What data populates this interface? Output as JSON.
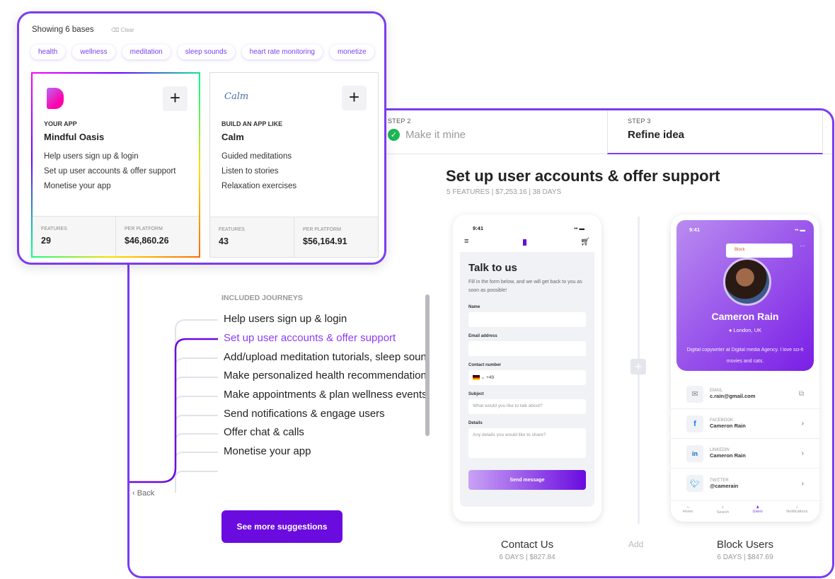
{
  "filter": {
    "showing": "Showing 6 bases",
    "clear": "Clear",
    "tags": [
      "health",
      "wellness",
      "meditation",
      "sleep sounds",
      "heart rate monitoring",
      "monetize"
    ]
  },
  "cards": [
    {
      "label": "YOUR APP",
      "name": "Mindful Oasis",
      "features": [
        "Help users sign up & login",
        "Set up user accounts & offer support",
        "Monetise your app"
      ],
      "features_label": "FEATURES",
      "features_count": "29",
      "price_label": "PER PLATFORM",
      "price": "$46,860.26",
      "logo": "B"
    },
    {
      "label": "BUILD AN APP LIKE",
      "name": "Calm",
      "features": [
        "Guided meditations",
        "Listen to stories",
        "Relaxation exercises"
      ],
      "features_label": "FEATURES",
      "features_count": "43",
      "price_label": "PER PLATFORM",
      "price": "$56,164.91",
      "logo": "Calm"
    }
  ],
  "steps": [
    {
      "step": "STEP 2",
      "title": "Make it mine",
      "done": true
    },
    {
      "step": "STEP 3",
      "title": "Refine idea",
      "active": true
    }
  ],
  "journey": {
    "title": "Set up user accounts & offer support",
    "meta": "5 FEATURES | $7,253.16 | 38 DAYS",
    "included_label": "INCLUDED JOURNEYS",
    "items": [
      "Help users sign up & login",
      "Set up user accounts & offer support",
      "Add/upload meditation tutorials, sleep sounds",
      "Make personalized health recommendations",
      "Make appointments & plan wellness events",
      "Send notifications & engage users",
      "Offer chat & calls",
      "Monetise your app"
    ],
    "back": "Back",
    "more_button": "See more suggestions",
    "accent": "#7b3cf0"
  },
  "contact_phone": {
    "time": "9:41",
    "heading": "Talk to us",
    "intro": "Fill in the form below, and we will get back to you as soon as possible!",
    "name_label": "Name",
    "email_label": "Email address",
    "contact_label": "Contact number",
    "dial_code": "+49",
    "subject_label": "Subject",
    "subject_placeholder": "What would you like to talk about?",
    "details_label": "Details",
    "details_placeholder": "Any details you would like to share?",
    "send": "Send message"
  },
  "profile_phone": {
    "time": "9:41",
    "menu_item": "Block",
    "name": "Cameron Rain",
    "location": "London, UK",
    "bio": "Digital copywriter at Digital media Agency. I love sci-fi movies and cats.",
    "rows": [
      {
        "label": "EMAIL",
        "value": "c.rain@gmail.com",
        "icon": "mail"
      },
      {
        "label": "FACEBOOK",
        "value": "Cameron Rain",
        "icon": "facebook"
      },
      {
        "label": "LINKEDIN",
        "value": "Cameron Rain",
        "icon": "linkedin"
      },
      {
        "label": "TWITTER",
        "value": "@camerain",
        "icon": "twitter"
      }
    ],
    "nav": [
      "Home",
      "Search",
      "Users",
      "Notifications"
    ]
  },
  "features": [
    {
      "name": "Contact Us",
      "meta": "6 DAYS | $827.84"
    },
    {
      "name": "Block Users",
      "meta": "6 DAYS | $847.69"
    }
  ],
  "add_label": "Add"
}
